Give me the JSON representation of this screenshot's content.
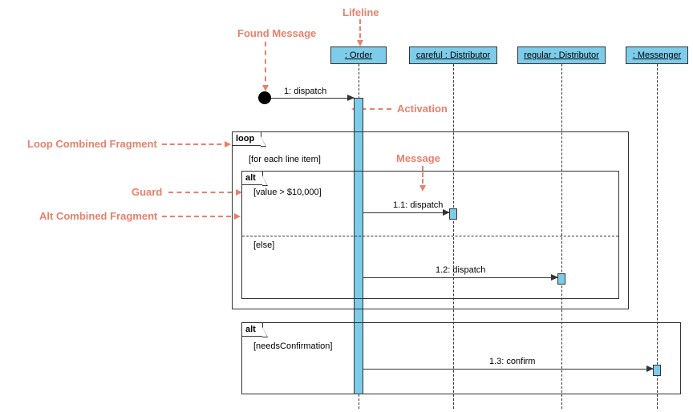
{
  "annotations": {
    "lifeline": "Lifeline",
    "foundMessage": "Found Message",
    "activation": "Activation",
    "loopFragment": "Loop Combined Fragment",
    "message": "Message",
    "guard": "Guard",
    "altFragment": "Alt Combined Fragment"
  },
  "lifelines": {
    "order": ": Order",
    "careful": "careful : Distributor",
    "regular": "regular : Distributor",
    "messenger": ": Messenger"
  },
  "fragments": {
    "loop": {
      "label": "loop",
      "guard": "[for each line item]"
    },
    "alt1": {
      "label": "alt",
      "guard1": "[value > $10,000]",
      "guard2": "[else]"
    },
    "alt2": {
      "label": "alt",
      "guard": "[needsConfirmation]"
    }
  },
  "messages": {
    "m1": "1: dispatch",
    "m11": "1.1: dispatch",
    "m12": "1.2: dispatch",
    "m13": "1.3: confirm"
  }
}
